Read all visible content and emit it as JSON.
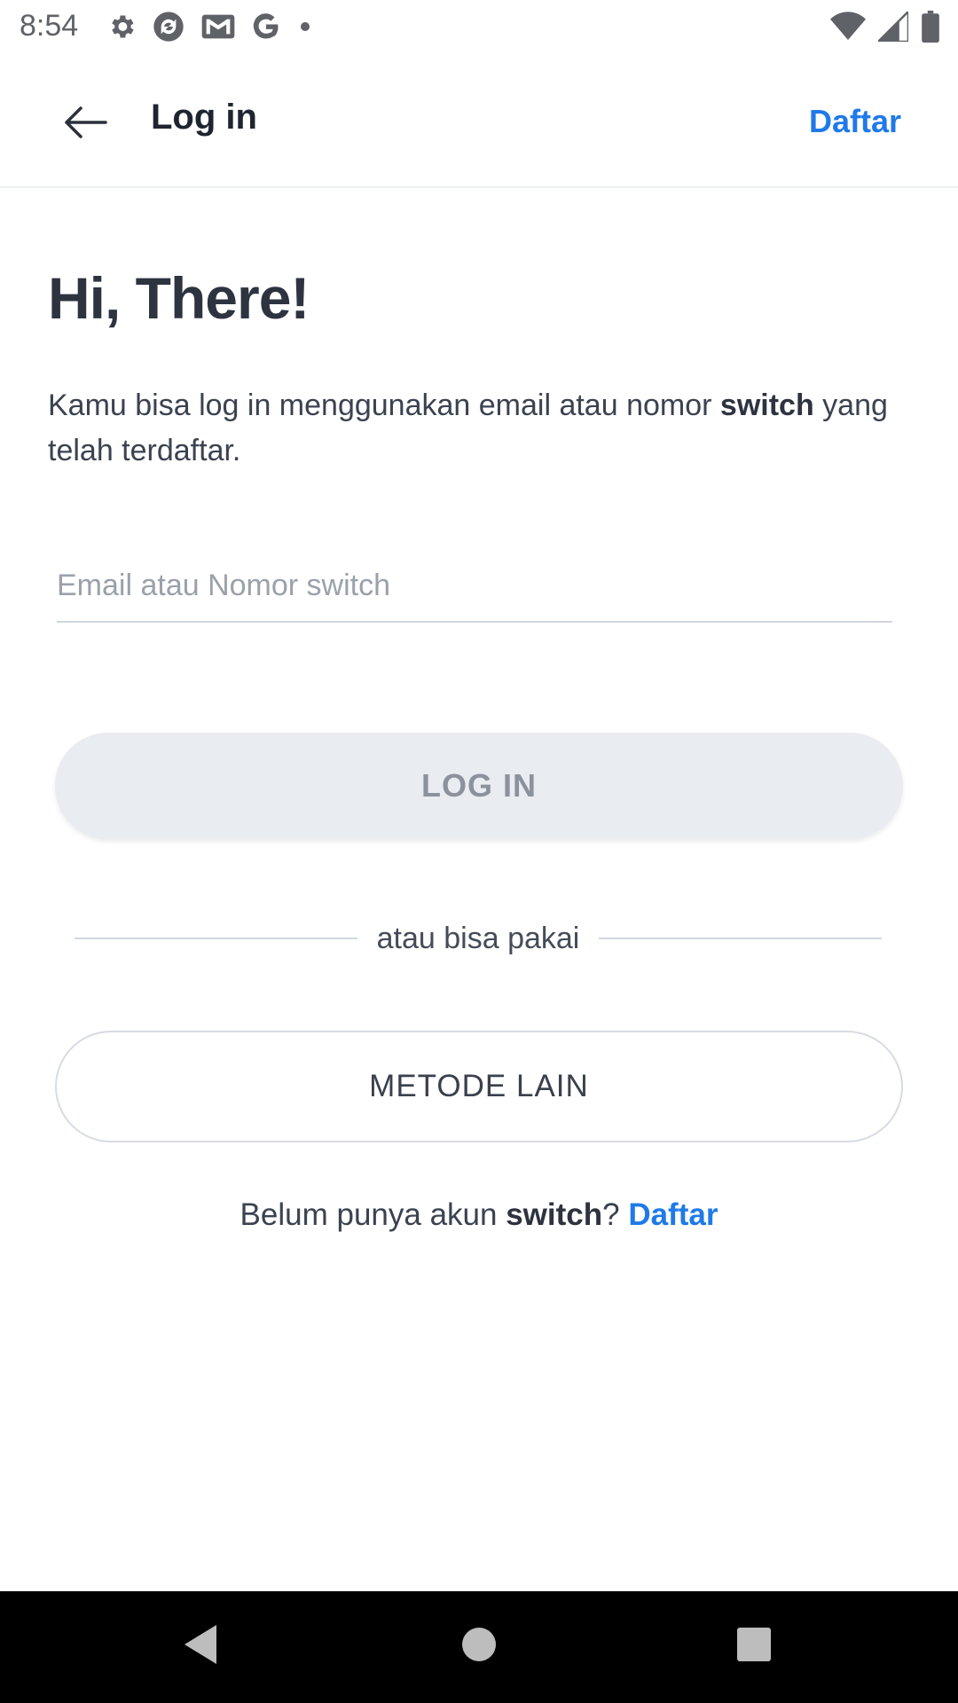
{
  "status_bar": {
    "time": "8:54",
    "left_icons": [
      "gear-icon",
      "sync-icon",
      "gmail-icon",
      "google-icon",
      "dot-icon"
    ],
    "right_icons": [
      "wifi-icon",
      "signal-icon",
      "battery-icon"
    ]
  },
  "app_bar": {
    "title": "Log in",
    "action_label": "Daftar",
    "back_icon": "arrow-left-icon"
  },
  "greeting": "Hi, There!",
  "intro": {
    "text_before": "Kamu bisa log in menggunakan email atau nomor ",
    "bold": "switch",
    "text_after": " yang telah terdaftar."
  },
  "email_field": {
    "placeholder": "Email atau Nomor switch",
    "value": ""
  },
  "login_button_label": "LOG IN",
  "divider_text": "atau bisa pakai",
  "alt_method_button_label": "METODE LAIN",
  "signup": {
    "prefix": "Belum punya akun ",
    "bold": "switch",
    "suffix": "? ",
    "link": "Daftar"
  },
  "nav_bar": [
    "back-triangle-icon",
    "home-circle-icon",
    "recents-square-icon"
  ],
  "colors": {
    "accent": "#1f7ae8",
    "text_dark": "#2e3340",
    "button_disabled_bg": "#e9ecf0"
  }
}
